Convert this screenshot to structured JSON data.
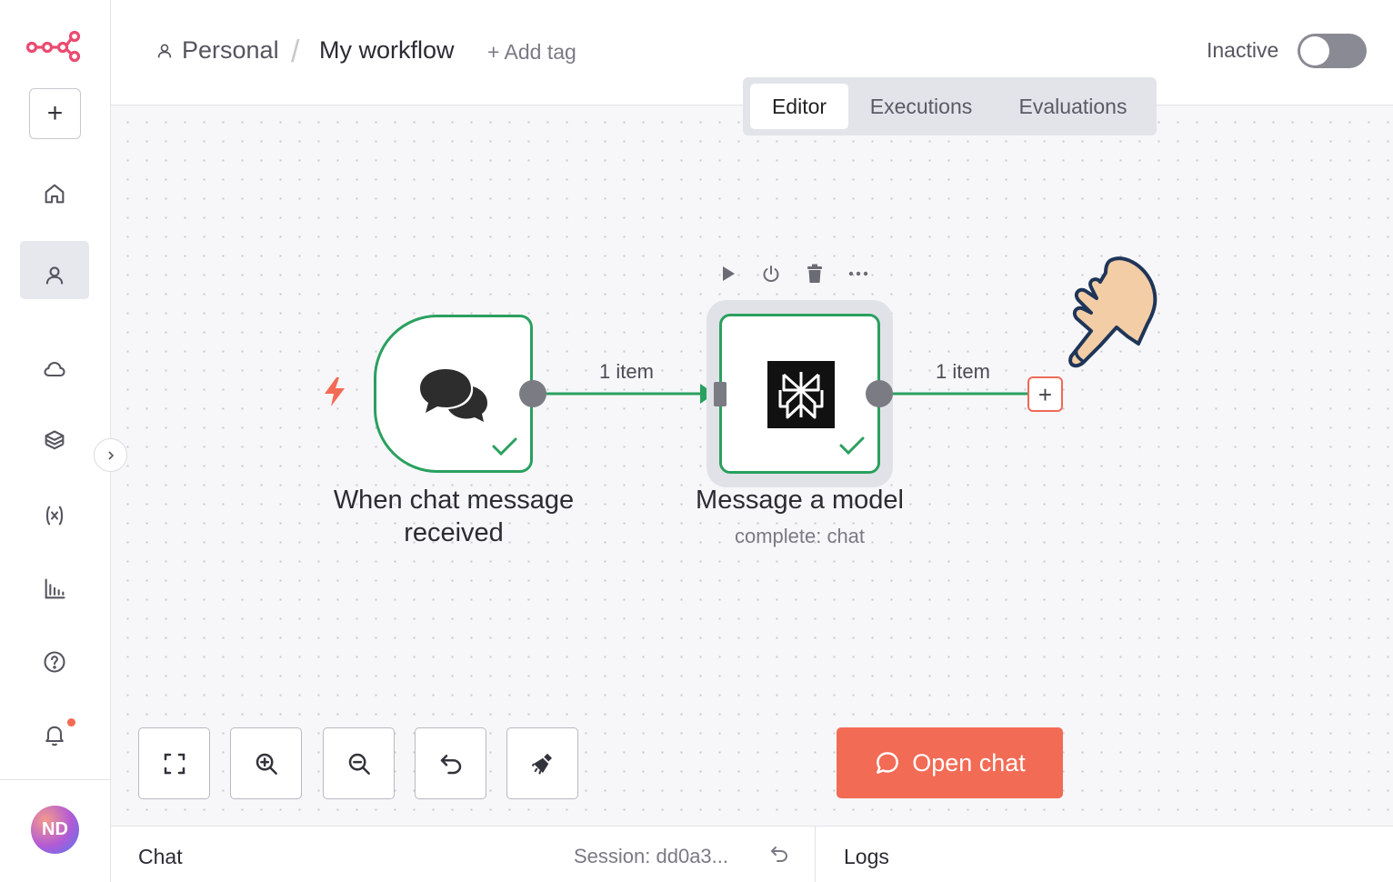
{
  "sidebar": {
    "logo_icon": "n8n-logo-icon",
    "new_button_label": "+",
    "items": [
      {
        "icon": "home-icon"
      },
      {
        "icon": "user-icon",
        "active": true
      },
      {
        "icon": "cloud-icon"
      },
      {
        "icon": "box-icon"
      },
      {
        "icon": "variables-icon"
      },
      {
        "icon": "insights-chart-icon"
      },
      {
        "icon": "help-icon"
      },
      {
        "icon": "bell-icon",
        "has_notification": true
      }
    ],
    "avatar_initials": "ND",
    "collapse_icon": "chevron-right-icon"
  },
  "header": {
    "breadcrumb_project": "Personal",
    "breadcrumb_separator": "/",
    "workflow_name": "My workflow",
    "add_tag": "+ Add tag",
    "status_label": "Inactive",
    "active": false
  },
  "tabs": [
    {
      "label": "Editor",
      "active": true
    },
    {
      "label": "Executions",
      "active": false
    },
    {
      "label": "Evaluations",
      "active": false
    }
  ],
  "canvas": {
    "nodes": [
      {
        "label_line1": "When chat message",
        "label_line2": "received",
        "icon": "chat-bubbles-icon",
        "trigger_icon": "lightning-icon",
        "status": "success"
      },
      {
        "label": "Message a model",
        "subtitle": "complete: chat",
        "icon": "perplexity-logo-icon",
        "status": "success"
      }
    ],
    "edges": [
      {
        "label": "1 item"
      },
      {
        "label": "1 item"
      }
    ],
    "node_toolbar": [
      "play-icon",
      "power-icon",
      "trash-icon",
      "more-icon"
    ],
    "add_node_label": "+"
  },
  "controls": {
    "buttons": [
      "fit-view-icon",
      "zoom-in-icon",
      "zoom-out-icon",
      "reset-zoom-icon",
      "tidy-up-icon"
    ],
    "open_chat_label": "Open chat"
  },
  "bottom_panel": {
    "chat_title": "Chat",
    "session": "Session: dd0a3...",
    "logs_title": "Logs"
  },
  "colors": {
    "accent": "#F26B55",
    "success": "#2AA05F",
    "canvas_bg": "#F7F7F9"
  }
}
